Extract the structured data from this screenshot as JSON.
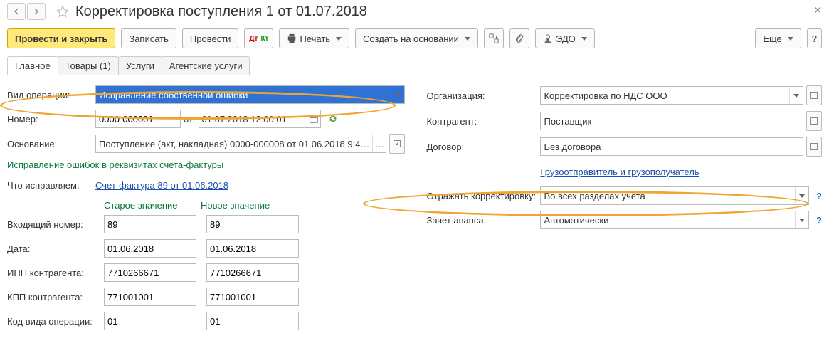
{
  "title": "Корректировка поступления 1 от 01.07.2018",
  "toolbar": {
    "post_close": "Провести и закрыть",
    "save": "Записать",
    "post": "Провести",
    "print": "Печать",
    "create_based": "Создать на основании",
    "edo": "ЭДО",
    "more": "Еще"
  },
  "tabs": {
    "main": "Главное",
    "goods": "Товары (1)",
    "services": "Услуги",
    "agent": "Агентские услуги"
  },
  "left": {
    "op_type_lbl": "Вид операции:",
    "op_type": "Исправление собственной ошибки",
    "number_lbl": "Номер:",
    "number": "0000-000001",
    "from_lbl": "от:",
    "date": "01.07.2018 12:00:01",
    "basis_lbl": "Основание:",
    "basis": "Поступление (акт, накладная) 0000-000008 от 01.06.2018 9:4…",
    "note": "Исправление ошибок в реквизитах счета-фактуры",
    "fix_lbl": "Что исправляем:",
    "fix_link": "Счет-фактура 89 от 01.06.2018",
    "old_hdr": "Старое значение",
    "new_hdr": "Новое значение",
    "in_num_lbl": "Входящий номер:",
    "in_num_old": "89",
    "in_num_new": "89",
    "date_lbl": "Дата:",
    "date_old": "01.06.2018",
    "date_new": "01.06.2018",
    "inn_lbl": "ИНН контрагента:",
    "inn_old": "7710266671",
    "inn_new": "7710266671",
    "kpp_lbl": "КПП контрагента:",
    "kpp_old": "771001001",
    "kpp_new": "771001001",
    "opcode_lbl": "Код вида операции:",
    "opcode_old": "01",
    "opcode_new": "01"
  },
  "right": {
    "org_lbl": "Организация:",
    "org": "Корректировка по НДС ООО",
    "contr_lbl": "Контрагент:",
    "contr": "Поставщик",
    "contract_lbl": "Договор:",
    "contract": "Без договора",
    "shipper_link": "Грузоотправитель и грузополучатель",
    "reflect_lbl": "Отражать корректировку:",
    "reflect": "Во всех разделах учета",
    "advance_lbl": "Зачет аванса:",
    "advance": "Автоматически"
  },
  "icons": {
    "question": "?",
    "ellipsis": "…"
  }
}
